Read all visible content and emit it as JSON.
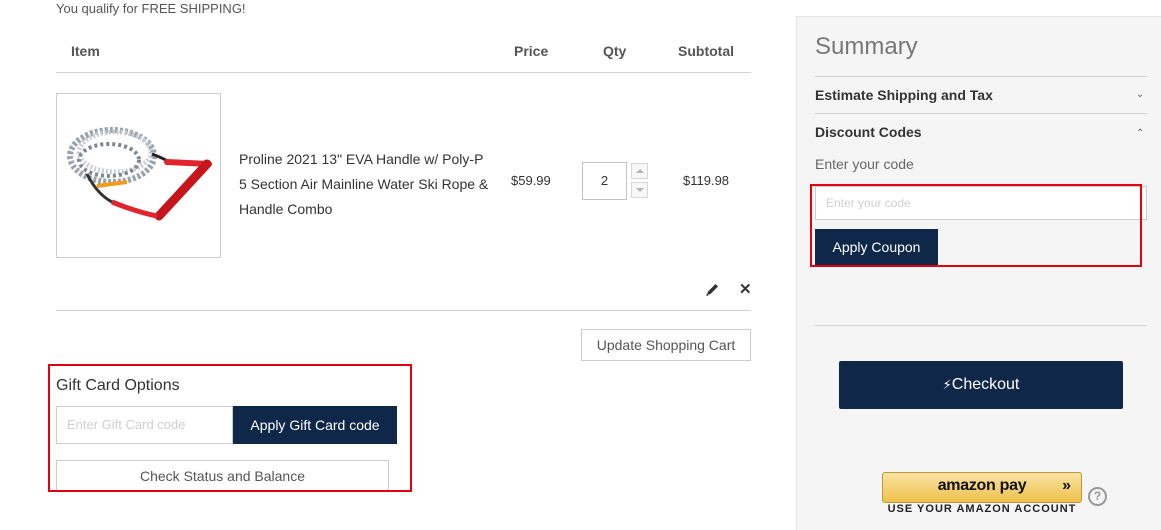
{
  "cart": {
    "free_shipping_msg": "You qualify for FREE SHIPPING!",
    "headers": {
      "item": "Item",
      "price": "Price",
      "qty": "Qty",
      "subtotal": "Subtotal"
    },
    "items": [
      {
        "name": "Proline 2021 13\" EVA Handle w/ Poly-P 5 Section Air Mainline Water Ski Rope & Handle Combo",
        "price": "$59.99",
        "qty": "2",
        "subtotal": "$119.98"
      }
    ],
    "update_label": "Update Shopping Cart"
  },
  "gift_card": {
    "title": "Gift Card Options",
    "placeholder": "Enter Gift Card code",
    "apply_label": "Apply Gift Card code",
    "check_label": "Check Status and Balance"
  },
  "summary": {
    "title": "Summary",
    "shipping_label": "Estimate Shipping and Tax",
    "discount_label": "Discount Codes",
    "code_label": "Enter your code",
    "code_placeholder": "Enter your code",
    "apply_coupon_label": "Apply Coupon",
    "checkout_label": "Checkout",
    "amazon_logo_text": "amazon pay",
    "amazon_tagline": "USE YOUR AMAZON ACCOUNT"
  },
  "icons": {
    "chevron_down": "chevron-down-icon",
    "chevron_up": "chevron-up-icon",
    "edit": "pencil-icon",
    "remove": "close-icon",
    "lightning": "lightning-icon",
    "help": "question-icon"
  },
  "colors": {
    "primary_button": "#0f2748",
    "highlight_border": "#e3000f",
    "summary_bg": "#f5f5f5",
    "amazon_button": "#f0c14b"
  }
}
